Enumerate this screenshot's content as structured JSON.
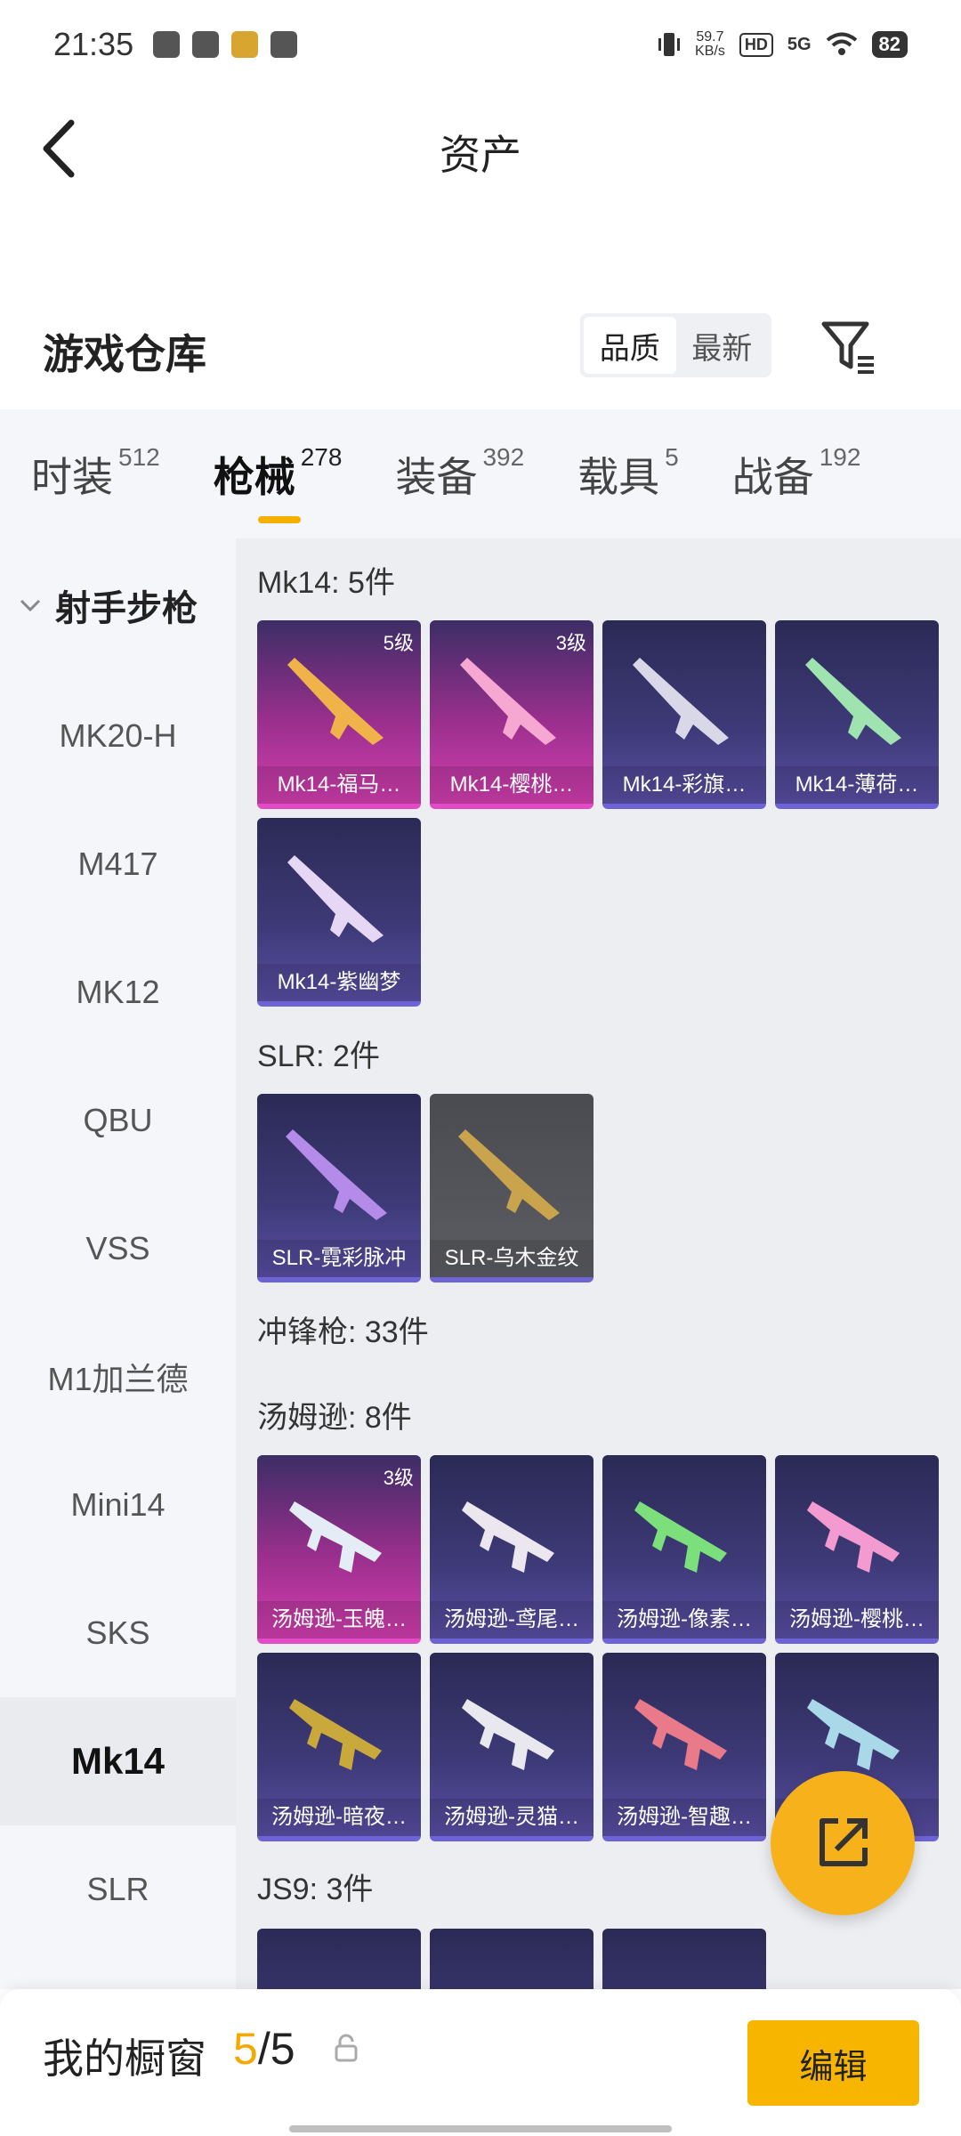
{
  "status_bar": {
    "time": "21:35",
    "speed_value": "59.7",
    "speed_unit": "KB/s",
    "hd": "HD",
    "network": "5G",
    "battery": "82"
  },
  "header": {
    "title": "资产"
  },
  "warehouse": {
    "title": "游戏仓库",
    "sort_options": [
      "品质",
      "最新"
    ]
  },
  "tabs": [
    {
      "label": "时装",
      "count": "512"
    },
    {
      "label": "枪械",
      "count": "278"
    },
    {
      "label": "装备",
      "count": "392"
    },
    {
      "label": "载具",
      "count": "5"
    },
    {
      "label": "战备",
      "count": "192"
    }
  ],
  "sidebar": {
    "category": "射手步枪",
    "items": [
      "MK20-H",
      "M417",
      "MK12",
      "QBU",
      "VSS",
      "M1加兰德",
      "Mini14",
      "SKS",
      "Mk14",
      "SLR"
    ]
  },
  "groups": {
    "mk14": {
      "title": "Mk14: 5件",
      "cards": [
        {
          "name": "Mk14-福马…",
          "level": "5级",
          "color": "pink"
        },
        {
          "name": "Mk14-樱桃…",
          "level": "3级",
          "color": "pink"
        },
        {
          "name": "Mk14-彩旗…",
          "level": "",
          "color": "purple"
        },
        {
          "name": "Mk14-薄荷…",
          "level": "",
          "color": "purple"
        },
        {
          "name": "Mk14-紫幽梦",
          "level": "",
          "color": "purple"
        }
      ]
    },
    "slr": {
      "title": "SLR: 2件",
      "cards": [
        {
          "name": "SLR-霓彩脉冲",
          "level": "",
          "color": "purple"
        },
        {
          "name": "SLR-乌木金纹",
          "level": "",
          "color": "gray"
        }
      ]
    },
    "smg": {
      "title": "冲锋枪: 33件"
    },
    "tommy": {
      "title": "汤姆逊: 8件",
      "cards": [
        {
          "name": "汤姆逊-玉魄…",
          "level": "3级",
          "color": "pink"
        },
        {
          "name": "汤姆逊-鸢尾…",
          "level": "",
          "color": "purple"
        },
        {
          "name": "汤姆逊-像素…",
          "level": "",
          "color": "purple"
        },
        {
          "name": "汤姆逊-樱桃…",
          "level": "",
          "color": "purple"
        },
        {
          "name": "汤姆逊-暗夜…",
          "level": "",
          "color": "purple"
        },
        {
          "name": "汤姆逊-灵猫…",
          "level": "",
          "color": "purple"
        },
        {
          "name": "汤姆逊-智趣…",
          "level": "",
          "color": "purple"
        },
        {
          "name": "",
          "level": "",
          "color": "purple"
        }
      ]
    },
    "js9": {
      "title": "JS9: 3件"
    }
  },
  "bottom_bar": {
    "label": "我的橱窗",
    "current": "5",
    "separator": "/",
    "total": "5",
    "edit_label": "编辑"
  },
  "colors": {
    "accent": "#f7b500",
    "pink_card": "#d33fb0",
    "purple_card": "#5a4fa5"
  }
}
